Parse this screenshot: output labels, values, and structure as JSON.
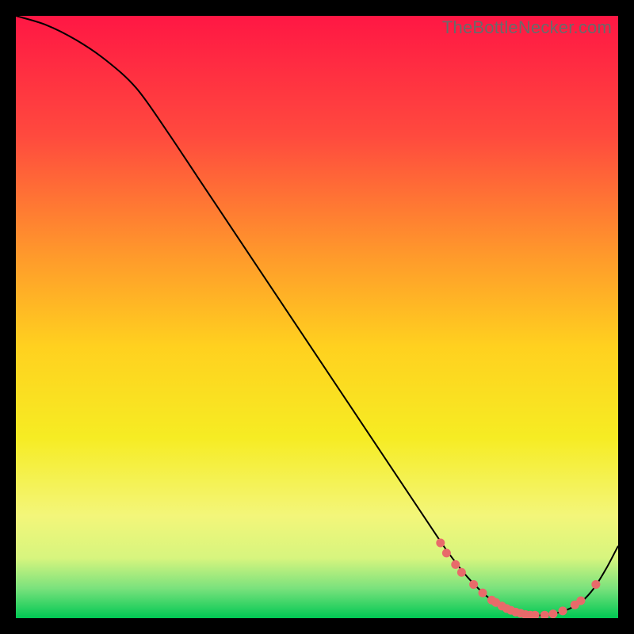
{
  "watermark": "TheBottleNecker.com",
  "chart_data": {
    "type": "line",
    "title": "",
    "xlabel": "",
    "ylabel": "",
    "xlim": [
      0,
      100
    ],
    "ylim": [
      0,
      100
    ],
    "background_gradient": {
      "type": "vertical",
      "stops": [
        {
          "t": 0.0,
          "color": "#ff1744"
        },
        {
          "t": 0.2,
          "color": "#ff4a3e"
        },
        {
          "t": 0.4,
          "color": "#ff9a2b"
        },
        {
          "t": 0.55,
          "color": "#ffd11f"
        },
        {
          "t": 0.7,
          "color": "#f6ec23"
        },
        {
          "t": 0.83,
          "color": "#f3f67a"
        },
        {
          "t": 0.9,
          "color": "#d7f57e"
        },
        {
          "t": 0.95,
          "color": "#7be27d"
        },
        {
          "t": 1.0,
          "color": "#00c853"
        }
      ]
    },
    "series": [
      {
        "name": "curve",
        "color": "#000000",
        "stroke_width": 2,
        "x": [
          0,
          5,
          10,
          15,
          20,
          25,
          30,
          35,
          40,
          45,
          50,
          55,
          60,
          65,
          70,
          72,
          75,
          78,
          80,
          82,
          84,
          86,
          88,
          90,
          92,
          94,
          96,
          98,
          100
        ],
        "y": [
          100,
          98.5,
          96,
          92.6,
          88,
          81,
          73.5,
          66,
          58.5,
          51,
          43.5,
          36,
          28.5,
          21,
          13.5,
          10.6,
          6.8,
          3.8,
          2.4,
          1.4,
          0.8,
          0.5,
          0.5,
          0.9,
          1.6,
          2.8,
          5.0,
          8.2,
          12
        ]
      }
    ],
    "markers": {
      "name": "dots",
      "color": "#e86a6a",
      "radius": 5.5,
      "points": [
        {
          "x": 70.5,
          "y": 12.5
        },
        {
          "x": 71.5,
          "y": 10.8
        },
        {
          "x": 73.0,
          "y": 8.9
        },
        {
          "x": 74.0,
          "y": 7.6
        },
        {
          "x": 76.0,
          "y": 5.6
        },
        {
          "x": 77.5,
          "y": 4.2
        },
        {
          "x": 79.0,
          "y": 3.0
        },
        {
          "x": 79.7,
          "y": 2.6
        },
        {
          "x": 80.7,
          "y": 2.0
        },
        {
          "x": 81.5,
          "y": 1.6
        },
        {
          "x": 82.2,
          "y": 1.3
        },
        {
          "x": 83.0,
          "y": 1.0
        },
        {
          "x": 83.8,
          "y": 0.8
        },
        {
          "x": 84.6,
          "y": 0.6
        },
        {
          "x": 85.4,
          "y": 0.5
        },
        {
          "x": 86.2,
          "y": 0.5
        },
        {
          "x": 87.8,
          "y": 0.5
        },
        {
          "x": 89.2,
          "y": 0.7
        },
        {
          "x": 90.8,
          "y": 1.2
        },
        {
          "x": 92.8,
          "y": 2.2
        },
        {
          "x": 93.8,
          "y": 2.9
        },
        {
          "x": 96.3,
          "y": 5.6
        }
      ]
    }
  }
}
